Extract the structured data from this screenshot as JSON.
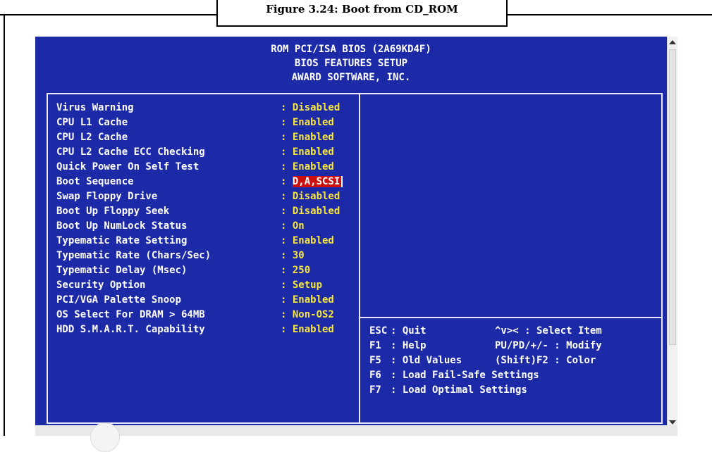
{
  "figure": {
    "caption": "Figure 3.24: Boot from CD_ROM"
  },
  "header": {
    "line1": "ROM PCI/ISA BIOS (2A69KD4F)",
    "line2": "BIOS FEATURES SETUP",
    "line3": "AWARD SOFTWARE, INC."
  },
  "settings": [
    {
      "label": "Virus Warning",
      "value": ": Disabled"
    },
    {
      "label": "CPU L1 Cache",
      "value": ": Enabled"
    },
    {
      "label": "CPU L2 Cache",
      "value": ": Enabled"
    },
    {
      "label": "CPU L2 Cache ECC Checking",
      "value": ": Enabled"
    },
    {
      "label": "Quick Power On Self Test",
      "value": ": Enabled"
    },
    {
      "label": "Boot Sequence",
      "value_prefix": ": ",
      "value": "D,A,SCSI",
      "selected": true
    },
    {
      "label": "Swap Floppy Drive",
      "value": ": Disabled"
    },
    {
      "label": "Boot Up Floppy Seek",
      "value": ": Disabled"
    },
    {
      "label": "Boot Up NumLock Status",
      "value": ": On"
    },
    {
      "label": "Typematic Rate Setting",
      "value": ": Enabled"
    },
    {
      "label": "Typematic Rate (Chars/Sec)",
      "value": ": 30"
    },
    {
      "label": "Typematic Delay (Msec)",
      "value": ": 250"
    },
    {
      "label": "Security Option",
      "value": ": Setup"
    },
    {
      "label": "PCI/VGA Palette Snoop",
      "value": ": Enabled"
    },
    {
      "label": "OS Select For DRAM > 64MB",
      "value": ": Non-OS2"
    },
    {
      "label": "HDD S.M.A.R.T. Capability",
      "value": ": Enabled"
    }
  ],
  "help": [
    {
      "key": "ESC",
      "desc": ": Quit",
      "right": "^v>< : Select Item"
    },
    {
      "key": "F1",
      "desc": ": Help",
      "right": "PU/PD/+/- : Modify"
    },
    {
      "key": "F5",
      "desc": ": Old Values",
      "right": "(Shift)F2 : Color"
    },
    {
      "key": "F6",
      "desc": ": Load Fail-Safe Settings",
      "right": ""
    },
    {
      "key": "F7",
      "desc": ": Load Optimal Settings",
      "right": ""
    }
  ],
  "colors": {
    "background": "#1c2aa8",
    "label": "#ffffff",
    "value": "#f7e63c",
    "selection": "#cc1010"
  },
  "icons": {
    "scroll_up": "triangle-up-icon",
    "scroll_down": "triangle-down-icon"
  }
}
